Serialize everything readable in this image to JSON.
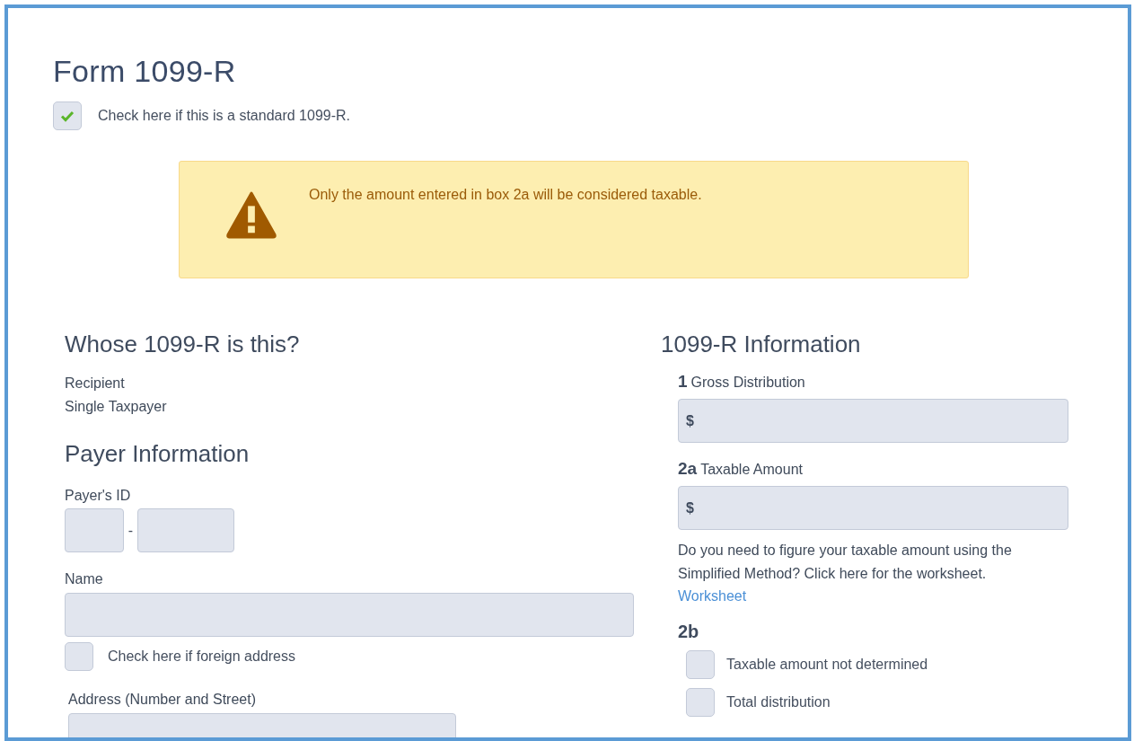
{
  "title": "Form 1099-R",
  "standard_check": {
    "label": "Check here if this is a standard 1099-R.",
    "checked": true
  },
  "alert": {
    "kind": "warning",
    "text": "Only the amount entered in box 2a will be considered taxable."
  },
  "whose": {
    "heading": "Whose 1099-R is this?",
    "lines": [
      "Recipient",
      "Single Taxpayer"
    ]
  },
  "payer": {
    "heading": "Payer Information",
    "id_label": "Payer's ID",
    "id_separator": "-",
    "name_label": "Name",
    "foreign": {
      "label": "Check here if foreign address",
      "checked": false
    },
    "address_label": "Address (Number and Street)"
  },
  "info": {
    "heading": "1099-R Information",
    "boxes": [
      {
        "number": "1",
        "label": "Gross Distribution",
        "prefix": "$"
      },
      {
        "number": "2a",
        "label": "Taxable Amount",
        "prefix": "$"
      }
    ],
    "note": "Do you need to figure your taxable amount using the Simplified Method? Click here for the worksheet.",
    "link": "Worksheet",
    "box2b": {
      "number": "2b",
      "checks": [
        {
          "label": "Taxable amount not determined",
          "checked": false
        },
        {
          "label": "Total distribution",
          "checked": false
        }
      ]
    }
  }
}
